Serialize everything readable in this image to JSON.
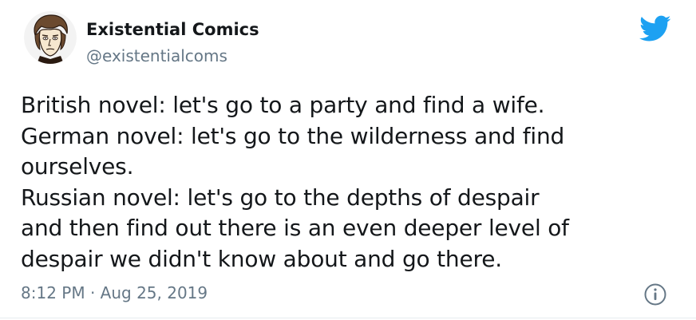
{
  "tweet": {
    "author": {
      "display_name": "Existential Comics",
      "handle": "@existentialcoms",
      "avatar_icon": "cartoon-portrait-avatar"
    },
    "platform_icon": "twitter-bird-icon",
    "text_lines": [
      "British novel: let's go to a party and find a wife.",
      "German novel: let's go to the wilderness and find",
      "ourselves.",
      "Russian novel: let's go to the depths of despair",
      "and then find out there is an even deeper level of",
      "despair we didn't know about and go there."
    ],
    "timestamp": "8:12 PM · Aug 25, 2019",
    "info_icon": "info-icon"
  },
  "colors": {
    "twitter_blue": "#1da1f2",
    "text_primary": "#14171a",
    "text_secondary": "#657786"
  }
}
